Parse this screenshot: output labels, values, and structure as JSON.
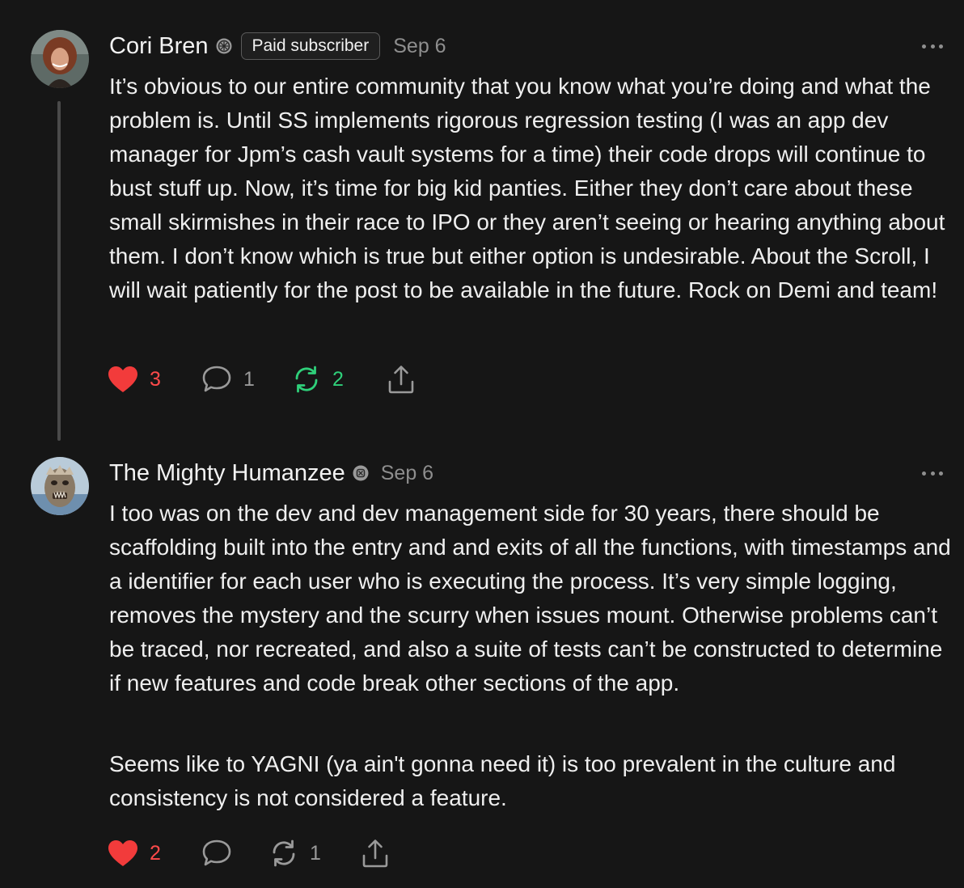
{
  "comments": [
    {
      "author": "Cori Bren",
      "badge": "Paid subscriber",
      "date": "Sep 6",
      "paragraphs": [
        "It’s obvious to our entire community that you know what you’re doing and what the problem is. Until SS implements rigorous regression testing (I was an app dev manager for Jpm’s cash vault systems for a time) their code drops will continue to bust stuff up. Now, it’s time for big kid panties. Either they don’t care about these small skirmishes in their race to IPO or they aren’t seeing or hearing anything about them. I don’t know which is true but either option is undesirable. About the Scroll, I will wait patiently for the post to be available in the future. Rock on Demi and team!"
      ],
      "likes": "3",
      "replies": "1",
      "restacks": "2",
      "liked": true,
      "restacked": true
    },
    {
      "author": "The Mighty Humanzee",
      "date": "Sep 6",
      "paragraphs": [
        "I too was on the dev and dev management side for 30 years, there should be scaffolding built into the entry and and exits of all the functions, with timestamps and a identifier for each user who is executing the process. It’s very simple logging, removes the mystery and the scurry when issues mount. Otherwise problems can’t be traced, nor recreated, and also a suite of tests can’t be constructed to determine if new features and code break other sections of the app.",
        "Seems like to YAGNI (ya ain't gonna need it) is too prevalent in the culture and consistency is not considered a feature."
      ],
      "likes": "2",
      "restacks": "1",
      "liked": true,
      "restacked": false
    }
  ],
  "icons": {
    "verified": "verified-badge-icon",
    "more": "more-dots-icon",
    "like": "heart-icon",
    "reply": "comment-bubble-icon",
    "restack": "restack-icon",
    "share": "share-icon"
  },
  "colors": {
    "background": "#161616",
    "like": "#ff4a4a",
    "restack": "#2fd07a",
    "muted": "#8e8e8e"
  }
}
